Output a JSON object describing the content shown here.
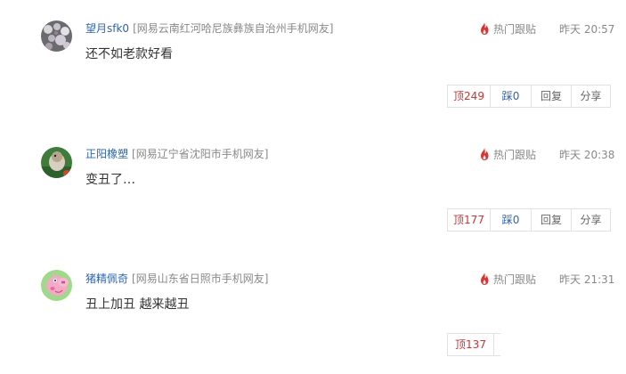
{
  "comments": [
    {
      "username": "望月sfk0",
      "location": "[网易云南红河哈尼族彝族自治州手机网友]",
      "hot_label": "热门跟贴",
      "time": "昨天 20:57",
      "content": "还不如老款好看",
      "up_label": "顶",
      "up_count": "249",
      "down_label": "踩",
      "down_count": "0",
      "reply_label": "回复",
      "share_label": "分享"
    },
    {
      "username": "正阳橡塑",
      "location": "[网易辽宁省沈阳市手机网友]",
      "hot_label": "热门跟贴",
      "time": "昨天 20:38",
      "content": "变丑了…",
      "up_label": "顶",
      "up_count": "177",
      "down_label": "踩",
      "down_count": "0",
      "reply_label": "回复",
      "share_label": "分享"
    },
    {
      "username": "猪精佩奇",
      "location": "[网易山东省日照市手机网友]",
      "hot_label": "热门跟贴",
      "time": "昨天 21:31",
      "content": "丑上加丑 越来越丑",
      "up_label": "顶",
      "up_count": "137"
    }
  ],
  "icons": {
    "hot": "fire-icon"
  },
  "colors": {
    "username": "#2f64b1",
    "up": "#cc3333",
    "down": "#2f64b1",
    "fire": "#e0312f"
  }
}
